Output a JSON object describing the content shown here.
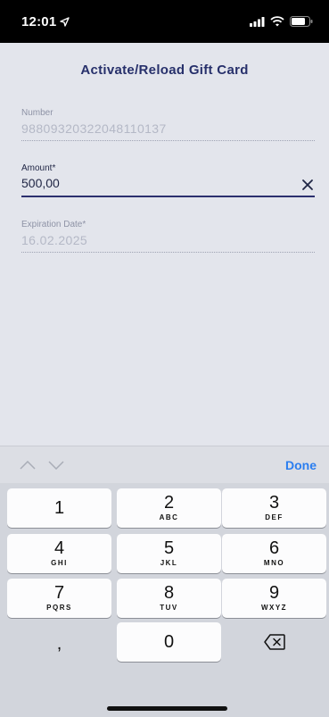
{
  "status_bar": {
    "time": "12:01"
  },
  "title": "Activate/Reload Gift Card",
  "fields": {
    "number": {
      "label": "Number",
      "value": "9880932032204811013­7"
    },
    "amount": {
      "label": "Amount*",
      "value": "500,00"
    },
    "expiration": {
      "label": "Expiration Date*",
      "value": "16.02.2025"
    }
  },
  "accessory": {
    "done_label": "Done"
  },
  "keypad": {
    "keys": [
      {
        "num": "1",
        "letters": ""
      },
      {
        "num": "2",
        "letters": "ABC"
      },
      {
        "num": "3",
        "letters": "DEF"
      },
      {
        "num": "4",
        "letters": "GHI"
      },
      {
        "num": "5",
        "letters": "JKL"
      },
      {
        "num": "6",
        "letters": "MNO"
      },
      {
        "num": "7",
        "letters": "PQRS"
      },
      {
        "num": "8",
        "letters": "TUV"
      },
      {
        "num": "9",
        "letters": "WXYZ"
      },
      {
        "num": ",",
        "letters": ""
      },
      {
        "num": "0",
        "letters": ""
      }
    ]
  }
}
